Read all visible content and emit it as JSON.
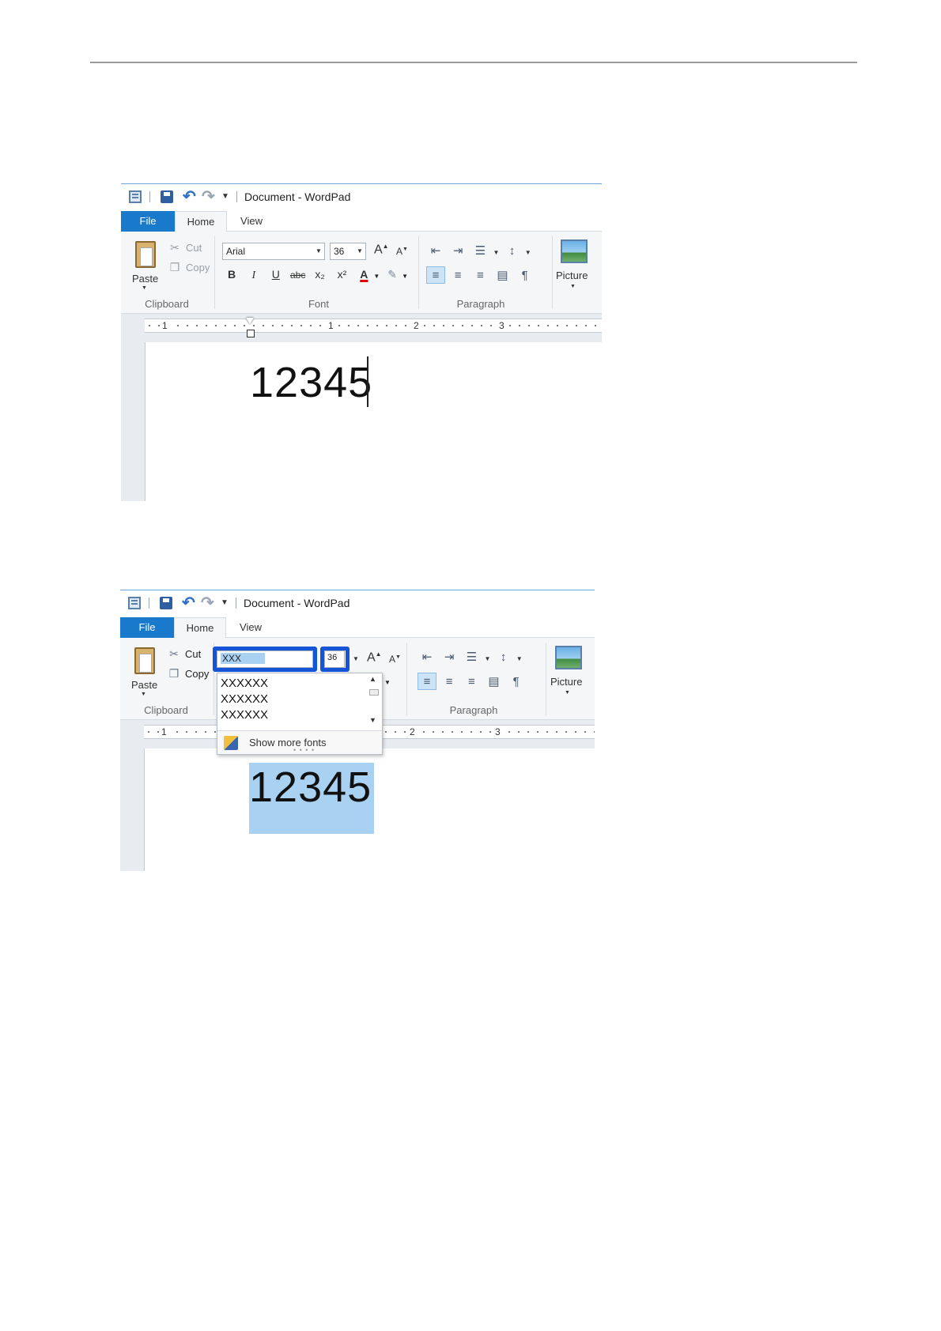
{
  "app": {
    "window_title": "Document - WordPad",
    "tabs": {
      "file": "File",
      "home": "Home",
      "view": "View"
    },
    "clipboard": {
      "paste": "Paste",
      "cut": "Cut",
      "copy": "Copy",
      "group_label": "Clipboard"
    },
    "font_group_label": "Font",
    "paragraph_group_label": "Paragraph",
    "picture_label": "Picture",
    "format_buttons": {
      "bold": "B",
      "italic": "I",
      "underline": "U",
      "strikethrough": "abc",
      "subscript": "x₂",
      "superscript": "x²",
      "font_color": "A"
    },
    "ruler_numbers": [
      "1",
      "1",
      "2",
      "3"
    ]
  },
  "screenshot1": {
    "font_name": "Arial",
    "font_size": "36",
    "document_text": "12345"
  },
  "screenshot2": {
    "font_name": "XXX",
    "font_size": "36",
    "font_options": [
      "XXXXXX",
      "XXXXXX",
      "XXXXXX"
    ],
    "show_more_fonts": "Show more fonts",
    "document_text": "12345",
    "highlight_color": "#1455d8",
    "selection_color": "#a9d1f2"
  }
}
